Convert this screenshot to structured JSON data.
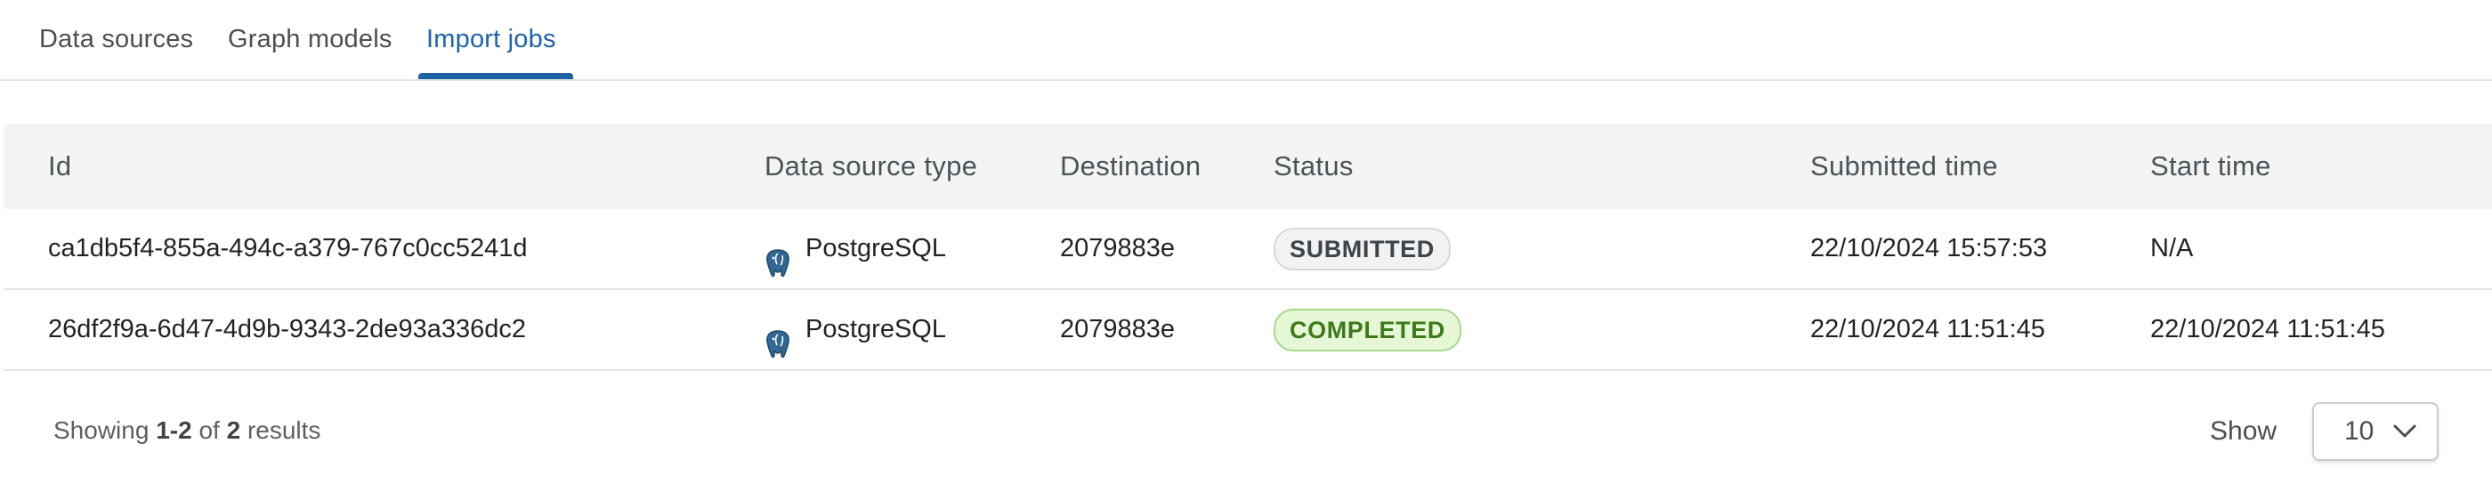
{
  "tabs": [
    {
      "label": "Data sources"
    },
    {
      "label": "Graph models"
    },
    {
      "label": "Import jobs"
    }
  ],
  "table": {
    "headers": {
      "id": "Id",
      "data_source_type": "Data source type",
      "destination": "Destination",
      "status": "Status",
      "submitted_time": "Submitted time",
      "start_time": "Start time"
    },
    "rows": [
      {
        "id": "ca1db5f4-855a-494c-a379-767c0cc5241d",
        "data_source_type": "PostgreSQL",
        "data_source_icon": "postgresql-elephant-icon",
        "destination": "2079883e",
        "status": "SUBMITTED",
        "submitted_time": "22/10/2024 15:57:53",
        "start_time": "N/A"
      },
      {
        "id": "26df2f9a-6d47-4d9b-9343-2de93a336dc2",
        "data_source_type": "PostgreSQL",
        "data_source_icon": "postgresql-elephant-icon",
        "destination": "2079883e",
        "status": "COMPLETED",
        "submitted_time": "22/10/2024 11:51:45",
        "start_time": "22/10/2024 11:51:45"
      }
    ]
  },
  "pagination": {
    "showing_prefix": "Showing",
    "range": "1-2",
    "of_word": "of",
    "total": "2",
    "results_word": "results",
    "show_label": "Show",
    "page_size": "10"
  },
  "colors": {
    "active_tab": "#1f63a6",
    "submitted_badge_bg": "#f1f2f3",
    "completed_badge_bg": "#e6f7d6",
    "completed_badge_text": "#3d7a1b",
    "header_bg": "#f3f5f5"
  }
}
